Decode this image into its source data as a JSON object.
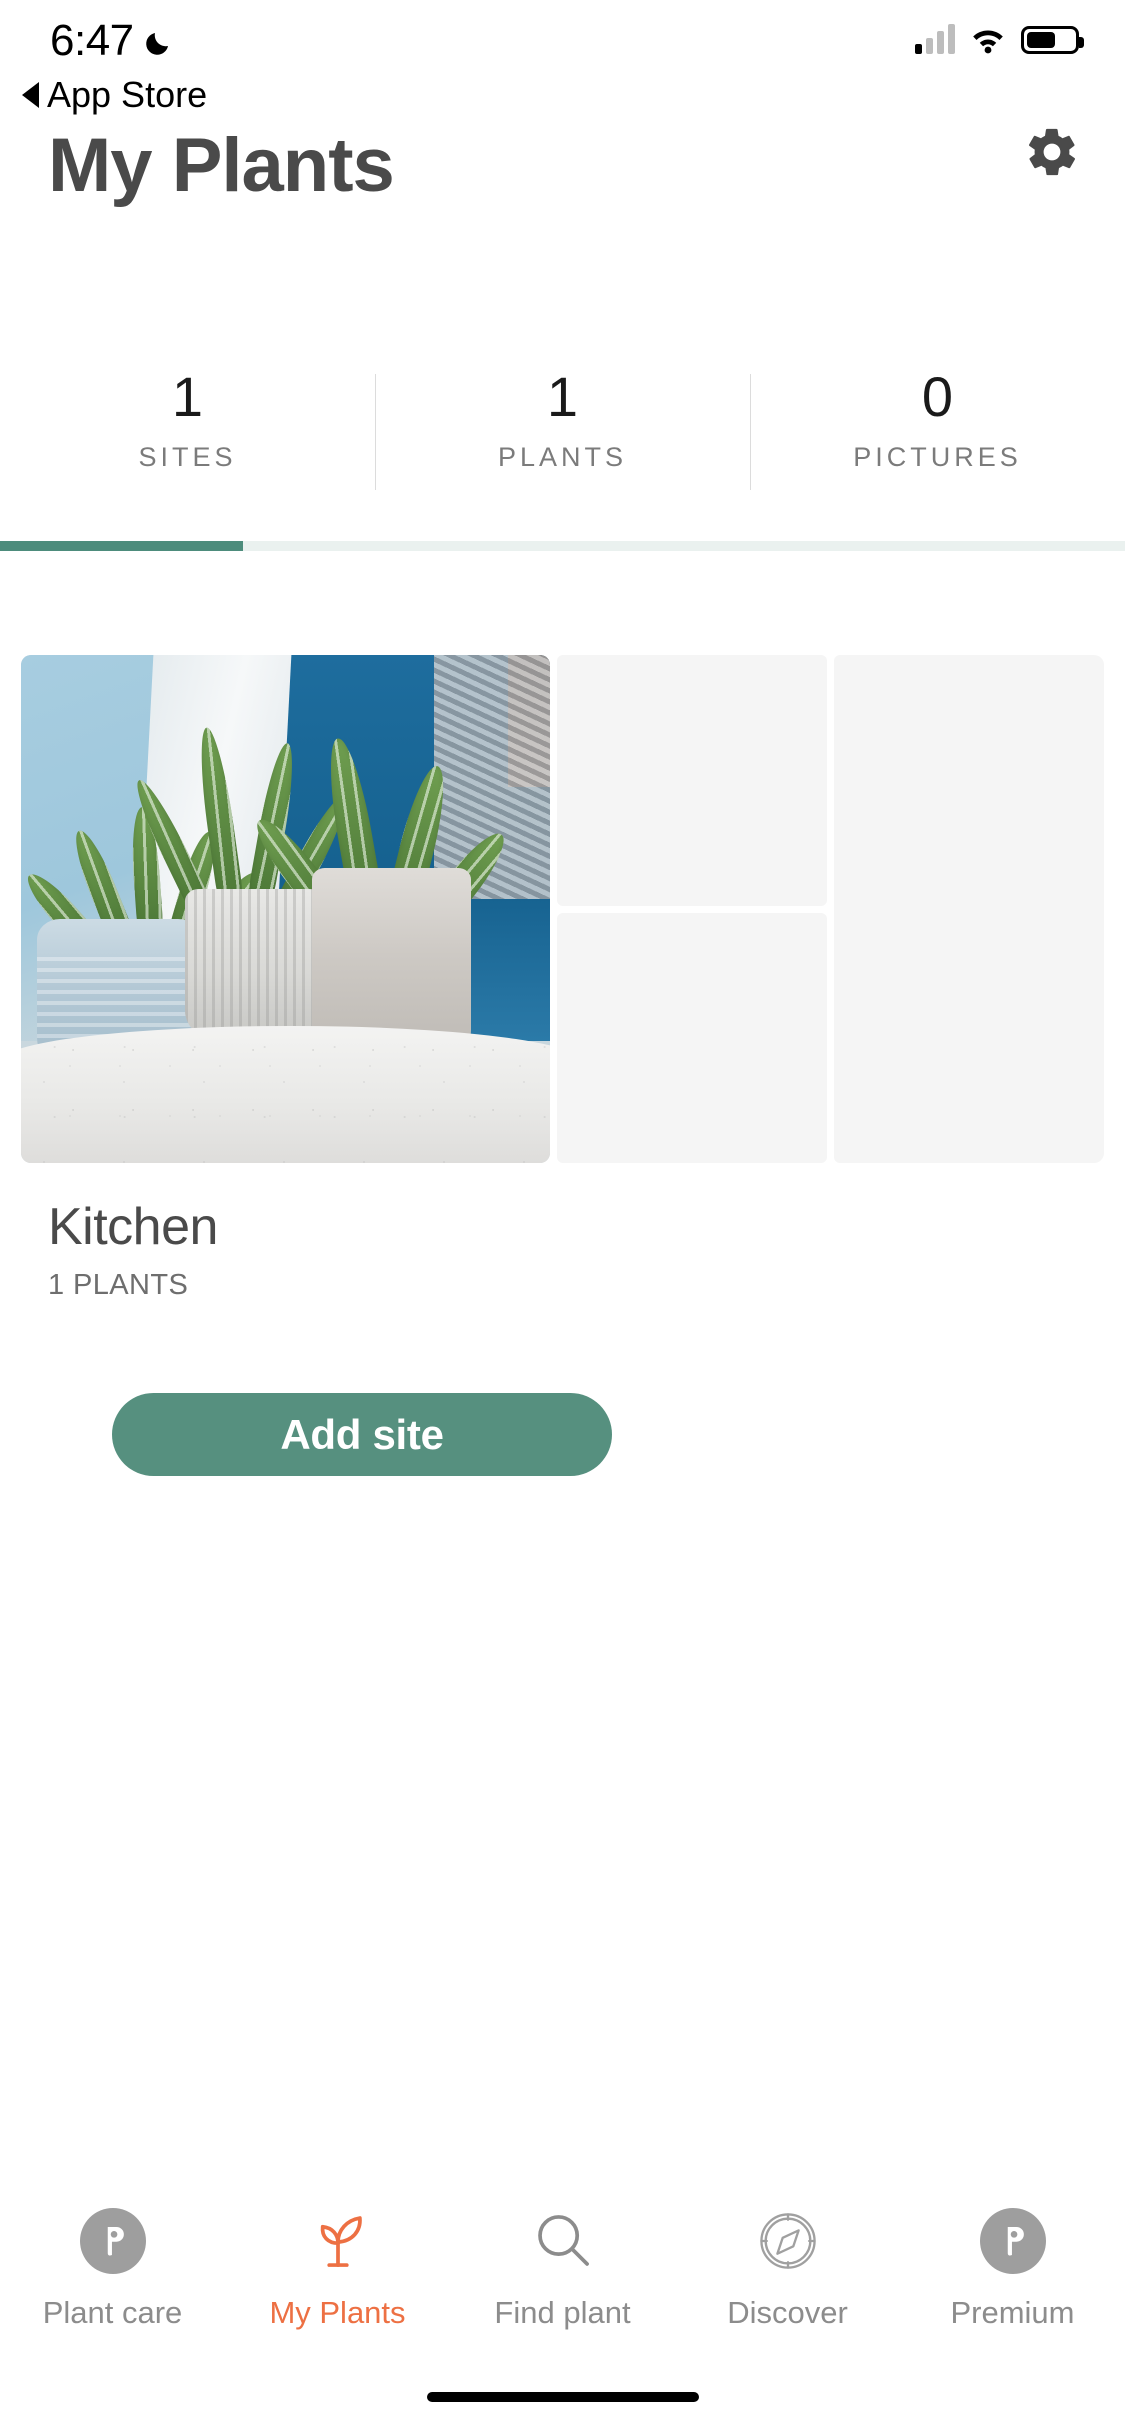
{
  "status_bar": {
    "time": "6:47",
    "dnd_icon": "moon-icon",
    "back_label": "App Store",
    "back_icon": "back-triangle-icon",
    "signal_icon": "cellular-signal-icon",
    "wifi_icon": "wifi-icon",
    "battery_icon": "battery-icon"
  },
  "header": {
    "title": "My Plants",
    "settings_icon": "gear-icon"
  },
  "stats": [
    {
      "value": "1",
      "label": "SITES"
    },
    {
      "value": "1",
      "label": "PLANTS"
    },
    {
      "value": "0",
      "label": "PICTURES"
    }
  ],
  "page_indicator": {
    "fill_percent": "21.6",
    "fill_color": "#4d8c7c",
    "track_color": "#eaf1ef"
  },
  "site_card": {
    "name": "Kitchen",
    "count_label": "1 PLANTS",
    "photo_alt": "succulent plants in gray pots",
    "empty_tiles": 3
  },
  "actions": {
    "add_site_label": "Add site",
    "add_site_color": "#56907f"
  },
  "tab_bar": {
    "active_color": "#ed7043",
    "inactive_color": "#8c8c8c",
    "items": [
      {
        "label": "Plant care",
        "icon": "plant-care-p-logo-icon",
        "active": false
      },
      {
        "label": "My Plants",
        "icon": "sprout-icon",
        "active": true
      },
      {
        "label": "Find plant",
        "icon": "search-icon",
        "active": false
      },
      {
        "label": "Discover",
        "icon": "compass-icon",
        "active": false
      },
      {
        "label": "Premium",
        "icon": "premium-p-logo-icon",
        "active": false
      }
    ]
  }
}
